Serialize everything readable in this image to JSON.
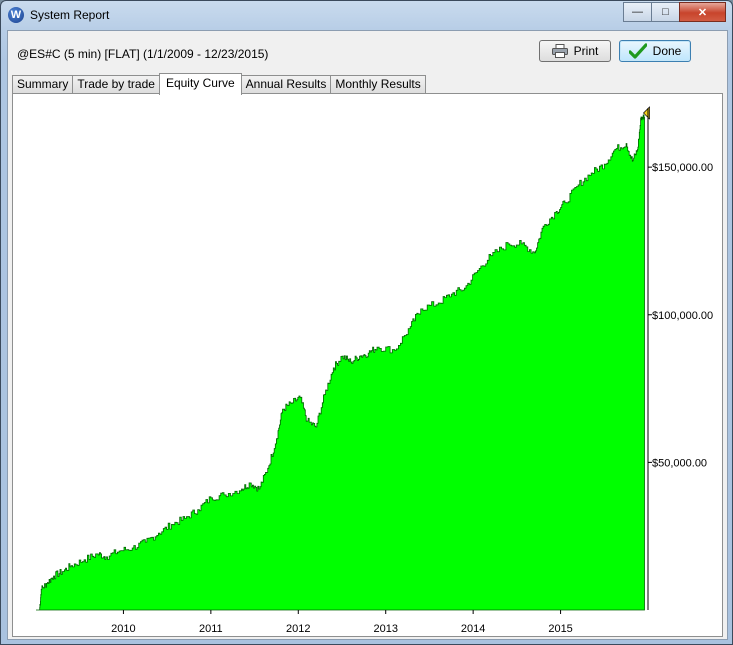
{
  "window": {
    "title": "System Report",
    "app_icon_letter": "W"
  },
  "report": {
    "title": "@ES#C (5 min) [FLAT]  (1/1/2009 - 12/23/2015)"
  },
  "buttons": {
    "print_label": "Print",
    "done_label": "Done"
  },
  "tabs": [
    {
      "label": "Summary",
      "active": false
    },
    {
      "label": "Trade by trade",
      "active": false
    },
    {
      "label": "Equity Curve",
      "active": true
    },
    {
      "label": "Annual Results",
      "active": false
    },
    {
      "label": "Monthly Results",
      "active": false
    }
  ],
  "chart_data": {
    "type": "area",
    "title": "",
    "xlabel": "",
    "ylabel": "",
    "fill_color": "#00ff00",
    "line_color": "#006600",
    "grid": false,
    "y_axis_side": "right",
    "xlim": [
      2009.0,
      2016.0
    ],
    "ylim": [
      0,
      168000
    ],
    "x_ticks": [
      2010,
      2011,
      2012,
      2013,
      2014,
      2015
    ],
    "x_tick_labels": [
      "2010",
      "2011",
      "2012",
      "2013",
      "2014",
      "2015"
    ],
    "y_ticks": [
      50000,
      100000,
      150000
    ],
    "y_tick_labels": [
      "$50,000.00",
      "$100,000.00",
      "$150,000.00"
    ],
    "series": [
      {
        "values": [
          [
            2009.0,
            0
          ],
          [
            2009.04,
            0
          ],
          [
            2009.06,
            7000
          ],
          [
            2009.12,
            9000
          ],
          [
            2009.2,
            11500
          ],
          [
            2009.3,
            13000
          ],
          [
            2009.4,
            15000
          ],
          [
            2009.55,
            17000
          ],
          [
            2009.7,
            19000
          ],
          [
            2009.8,
            18000
          ],
          [
            2009.95,
            20000
          ],
          [
            2010.1,
            21000
          ],
          [
            2010.25,
            23000
          ],
          [
            2010.4,
            26000
          ],
          [
            2010.55,
            29000
          ],
          [
            2010.7,
            31000
          ],
          [
            2010.85,
            34000
          ],
          [
            2011.0,
            38000
          ],
          [
            2011.15,
            39000
          ],
          [
            2011.35,
            41000
          ],
          [
            2011.45,
            43000
          ],
          [
            2011.55,
            41000
          ],
          [
            2011.65,
            48000
          ],
          [
            2011.75,
            58000
          ],
          [
            2011.82,
            68000
          ],
          [
            2011.92,
            70000
          ],
          [
            2012.02,
            72000
          ],
          [
            2012.1,
            64000
          ],
          [
            2012.2,
            62000
          ],
          [
            2012.3,
            73000
          ],
          [
            2012.4,
            82000
          ],
          [
            2012.5,
            86000
          ],
          [
            2012.6,
            84000
          ],
          [
            2012.7,
            86000
          ],
          [
            2012.8,
            87000
          ],
          [
            2012.9,
            89000
          ],
          [
            2013.1,
            88000
          ],
          [
            2013.28,
            96000
          ],
          [
            2013.4,
            102000
          ],
          [
            2013.6,
            104000
          ],
          [
            2013.75,
            107000
          ],
          [
            2013.9,
            109000
          ],
          [
            2014.05,
            115000
          ],
          [
            2014.2,
            120000
          ],
          [
            2014.4,
            124000
          ],
          [
            2014.55,
            124000
          ],
          [
            2014.7,
            121000
          ],
          [
            2014.8,
            130000
          ],
          [
            2014.95,
            135000
          ],
          [
            2015.05,
            138000
          ],
          [
            2015.2,
            144000
          ],
          [
            2015.35,
            148000
          ],
          [
            2015.5,
            151000
          ],
          [
            2015.62,
            156000
          ],
          [
            2015.75,
            158000
          ],
          [
            2015.82,
            152000
          ],
          [
            2015.88,
            156000
          ],
          [
            2015.92,
            167000
          ],
          [
            2015.96,
            167000
          ]
        ]
      }
    ],
    "end_marker_color": "#f5d01e"
  }
}
